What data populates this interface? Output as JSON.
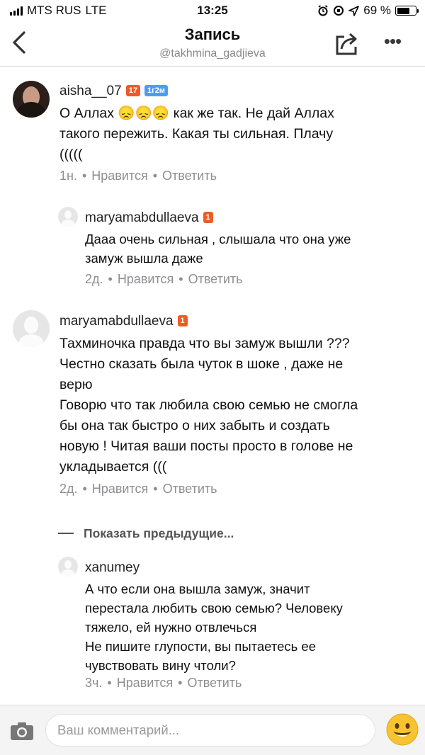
{
  "status_bar": {
    "carrier": "MTS RUS",
    "network": "LTE",
    "time": "13:25",
    "battery": "69 %"
  },
  "header": {
    "title": "Запись",
    "subtitle": "@takhmina_gadjieva",
    "back_icon": "chevron-left-icon",
    "share_icon": "share-icon",
    "more_icon": "more-dots-icon"
  },
  "comments": [
    {
      "username": "aisha__07",
      "badges": [
        "17",
        "1г2м"
      ],
      "text": "О Аллах 😞😞😞 как же так.  Не дай Аллах\nтакого пережить.  Какая ты сильная.   Плачу\n(((((",
      "time": "1н.",
      "like": "Нравится",
      "reply": "Ответить"
    },
    {
      "username": "maryamabdullaeva",
      "badges": [
        "1"
      ],
      "text": "Дааа очень сильная , слышала что она уже\nзамуж вышла даже",
      "time": "2д.",
      "like": "Нравится",
      "reply": "Ответить"
    },
    {
      "username": "maryamabdullaeva",
      "badges": [
        "1"
      ],
      "text": "Тахминочка правда что вы замуж вышли ???\nЧестно сказать была чуток в шоке , даже не\nверю\nГоворю что так любила свою семью не смогла\nбы она так быстро о них забыть и создать\nновую ! Читая ваши посты просто в голове не\nукладывается (((",
      "time": "2д.",
      "like": "Нравится",
      "reply": "Ответить"
    },
    {
      "username": "xanumey",
      "badges": [],
      "text": "А что если она вышла замуж, значит\nперестала любить свою семью? Человеку\nтяжело, ей нужно отвлечься\nНе пишите глупости, вы пытаетесь ее\nчувствовать вину чтоли?",
      "time": "3ч.",
      "like": "Нравится",
      "reply": "Ответить"
    }
  ],
  "show_previous": "Показать предыдущие...",
  "composer": {
    "placeholder": "Ваш комментарий...",
    "camera_icon": "camera-icon",
    "emoji_icon": "emoji-icon"
  },
  "colors": {
    "badge_orange": "#f15a24",
    "badge_blue": "#4a9ef0",
    "meta_gray": "#8e8e93"
  }
}
